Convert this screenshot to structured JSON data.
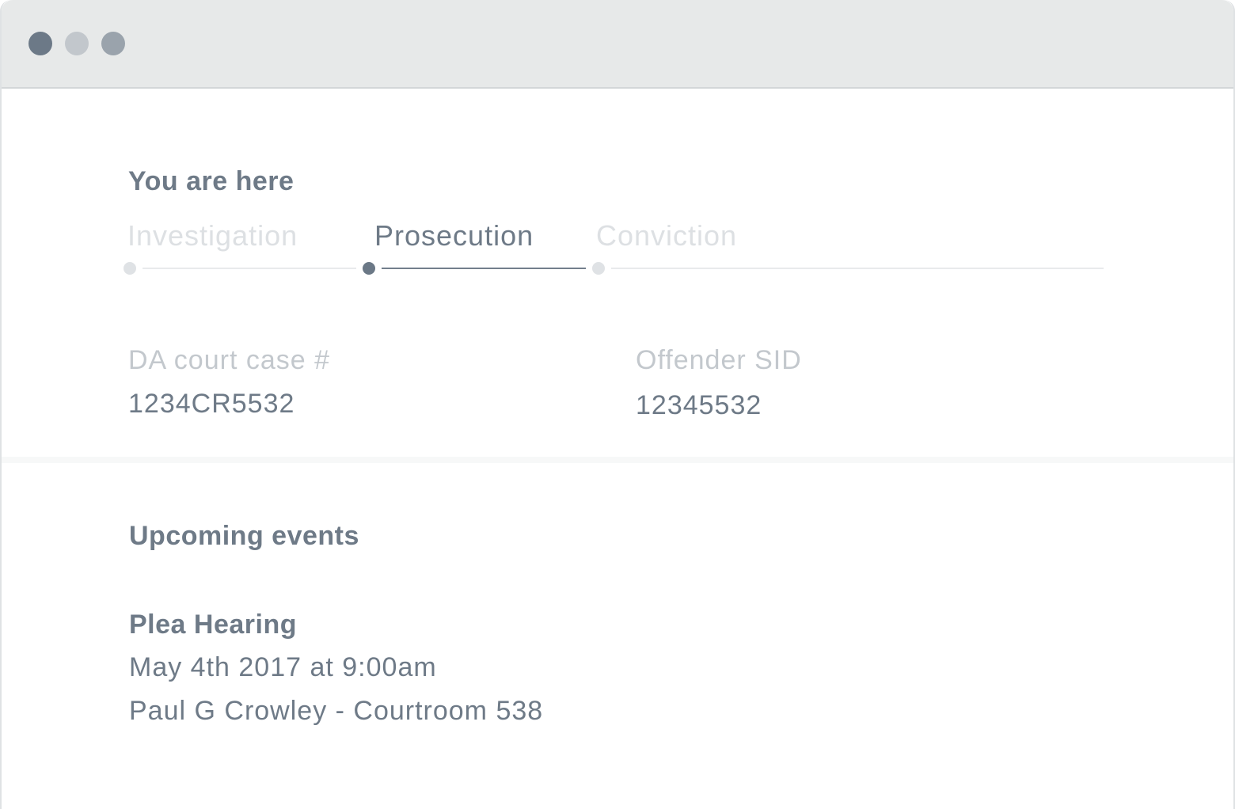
{
  "window": {
    "controls": [
      "close",
      "minimize",
      "zoom"
    ]
  },
  "location_section": {
    "title": "You are here",
    "steps": [
      {
        "label": "Investigation",
        "state": "inactive"
      },
      {
        "label": "Prosecution",
        "state": "active"
      },
      {
        "label": "Conviction",
        "state": "inactive"
      }
    ]
  },
  "case_fields": [
    {
      "label": "DA court case #",
      "value": "1234CR5532"
    },
    {
      "label": "Offender SID",
      "value": "12345532"
    }
  ],
  "upcoming_section": {
    "title": "Upcoming events",
    "events": [
      {
        "title": "Plea Hearing",
        "datetime": "May 4th 2017 at 9:00am",
        "location": "Paul G Crowley - Courtroom 538"
      }
    ]
  },
  "colors": {
    "text_primary": "#6e7a87",
    "text_muted": "#c3c8cd",
    "step_inactive": "#dde0e3",
    "titlebar_bg": "#e7e9e9"
  }
}
